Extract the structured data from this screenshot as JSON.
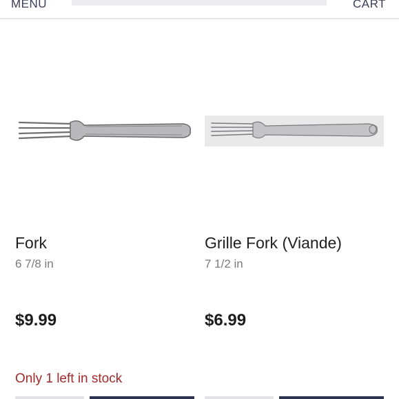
{
  "header": {
    "menu_label": "MENU",
    "cart_label": "CART"
  },
  "products": [
    {
      "title": "Fork",
      "size": "6 7/8 in",
      "price": "$9.99",
      "stock_note": "Only 1 left in stock"
    },
    {
      "title": "Grille Fork (Viande)",
      "size": "7 1/2 in",
      "price": "$6.99"
    }
  ],
  "colors": {
    "accent": "#2e3350",
    "stock_warning": "#a32a2a"
  }
}
